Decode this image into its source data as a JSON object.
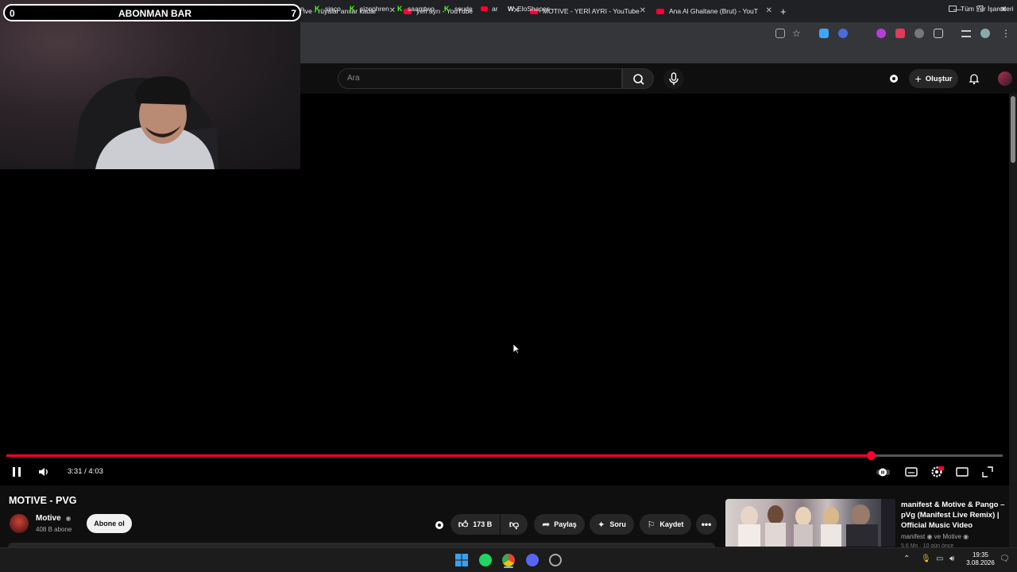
{
  "overlay": {
    "bar_left": "0",
    "bar_title": "ABONMAN BAR",
    "bar_right": "7"
  },
  "browser": {
    "tabs": [
      {
        "title": "ive - rüyalar anılar kadar ön"
      },
      {
        "title": "yeri ayrı - YouTube"
      },
      {
        "title": "MOTIVE - YERİ AYRI - YouTube"
      },
      {
        "title": "Ana Al Ghaltane (Brut) - YouTube"
      }
    ],
    "new_tab": "+",
    "bookmarks": [
      {
        "label": "n",
        "icon": "none"
      },
      {
        "label": "sinco",
        "icon": "kick"
      },
      {
        "label": "sizophren",
        "icon": "kick"
      },
      {
        "label": "saamtwo",
        "icon": "kick"
      },
      {
        "label": "ssude",
        "icon": "kick"
      },
      {
        "label": "ar",
        "icon": "youtube"
      },
      {
        "label": "EloShapes -",
        "icon": "eloshapes"
      }
    ],
    "all_bookmarks": "Tüm Yer İşaretleri"
  },
  "youtube": {
    "search_placeholder": "Ara",
    "create_label": "Oluştur",
    "player": {
      "time": "3:31 / 4:03",
      "progress": 0.868
    },
    "video_title": "MOTIVE - PVG",
    "channel_name": "Motive",
    "channel_subs": "408 B abone",
    "subscribe_label": "Abone ol",
    "like_count": "173 B",
    "share_label": "Paylaş",
    "ask_label": "Soru",
    "save_label": "Kaydet",
    "recommended": {
      "title": "manifest & Motive & Pango – pVg (Manifest Live Remix) | Official Music Video",
      "channel": "manifest",
      "channel_join": "ve Motive",
      "meta": "5,6 Mn · 10 gün önce"
    }
  },
  "taskbar": {
    "time": "19:35",
    "date": "3.08.2026"
  },
  "colors": {
    "youtube_red": "#ff0033",
    "kick_green": "#53fc18"
  }
}
